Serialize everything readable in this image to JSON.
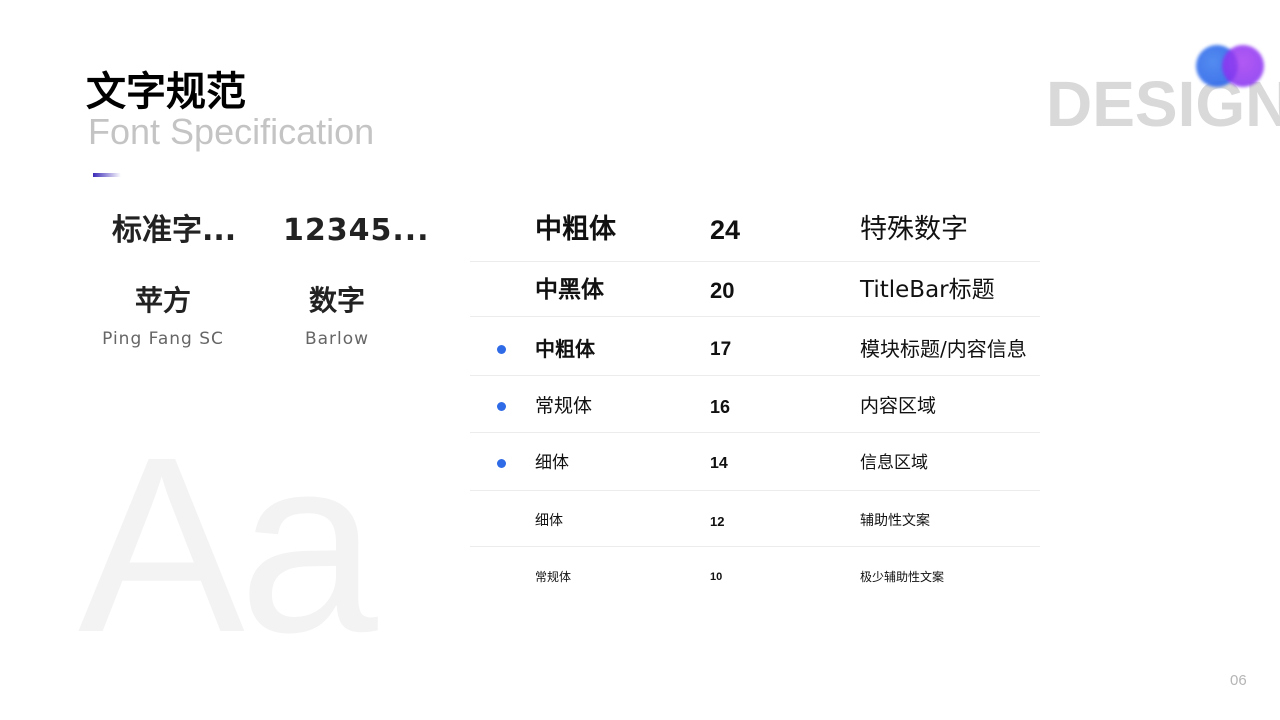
{
  "header": {
    "title": "文字规范",
    "subtitle": "Font Specification",
    "watermark": "DESIGN",
    "bg_letters": "Aa"
  },
  "samples": {
    "cn_text": "标准字...",
    "number_text": "12345..."
  },
  "fonts": [
    {
      "name": "苹方",
      "sub": "Ping Fang SC"
    },
    {
      "name": "数字",
      "sub": "Barlow"
    }
  ],
  "spec_rows": [
    {
      "weight": "中粗体",
      "size": "24",
      "usage": "特殊数字",
      "dot": false
    },
    {
      "weight": "中黑体",
      "size": "20",
      "usage": "TitleBar标题",
      "dot": false
    },
    {
      "weight": "中粗体",
      "size": "17",
      "usage": "模块标题/内容信息",
      "dot": true
    },
    {
      "weight": "常规体",
      "size": "16",
      "usage": "内容区域",
      "dot": true
    },
    {
      "weight": "细体",
      "size": "14",
      "usage": "信息区域",
      "dot": true
    },
    {
      "weight": "细体",
      "size": "12",
      "usage": "辅助性文案",
      "dot": false
    },
    {
      "weight": "常规体",
      "size": "10",
      "usage": "极少辅助性文案",
      "dot": false
    }
  ],
  "page_number": "06",
  "colors": {
    "accent_blue": "#2f6be6",
    "accent_purple": "#7b2cf0",
    "accent_bar": "#3b2bb8",
    "watermark": "#d9d9d9"
  }
}
